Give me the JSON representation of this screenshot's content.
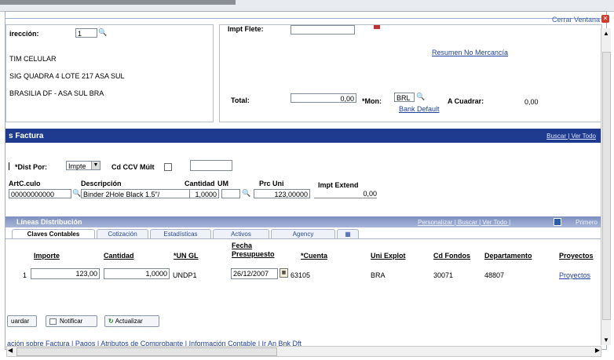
{
  "window": {
    "close_link": "Cerrar Ventana",
    "close_icon": "close-icon"
  },
  "header_left": {
    "direccion_label": "irección:",
    "direccion_value": "1",
    "address_lines": [
      "TIM CELULAR",
      "SIG QUADRA 4 LOTE 217 ASA SUL",
      "BRASILIA DF - ASA SUL  BRA"
    ]
  },
  "header_right": {
    "impt_flete_label": "Impt Flete:",
    "resumen_link": "Resumen No Mercancía",
    "total_label": "Total:",
    "total_value": "0,00",
    "mon_label": "*Mon:",
    "mon_value": "BRL",
    "bank_default_link": "Bank Default",
    "a_cuadrar_label": "A Cuadrar:",
    "a_cuadrar_value": "0,00"
  },
  "lineas_factura": {
    "title": "s Factura",
    "nav": "Buscar | Ver Todo",
    "dist_por_label": "*Dist Por:",
    "dist_por_value": "Impte",
    "cd_ccv_label": "Cd CCV Múlt",
    "columns": [
      "ArtC.culo",
      "Descripción",
      "Cantidad",
      "UM",
      "Prc Uni",
      "Impt Extend"
    ],
    "row": {
      "articulo": "00000000000",
      "descripcion": "Binder 2Hole Black 1.5\"/",
      "cantidad": "1,0000",
      "um": "",
      "prc_uni": "123,00000",
      "impt_extend": "0,00"
    }
  },
  "lineas_distribucion": {
    "title": "Líneas Distribución",
    "nav": "Personalizar | Buscar | Ver Todo |",
    "nav_end": "Primero",
    "tabs": [
      "Claves Contables",
      "Cotización",
      "Estadísticas",
      "Activos",
      "Agency"
    ],
    "columns": [
      "Importe",
      "Cantidad",
      "*UN GL",
      "Fecha Presupuesto",
      "*Cuenta",
      "Uni Explot",
      "Cd Fondos",
      "Departamento",
      "Proyectos"
    ],
    "row": {
      "num": "1",
      "importe": "123,00",
      "cantidad": "1,0000",
      "un_gl": "UNDP1",
      "fecha": "26/12/2007",
      "cuenta": "63105",
      "uni_explot": "BRA",
      "cd_fondos": "30071",
      "departamento": "48807",
      "proyectos": "Proyectos"
    }
  },
  "buttons": {
    "guardar": "uardar",
    "notificar": "Notificar",
    "actualizar": "Actualizar"
  },
  "footer_links": "ación sobre Factura | Pagos | Atributos de Comprobante | Información Contable | Ir An Bnk Dft"
}
